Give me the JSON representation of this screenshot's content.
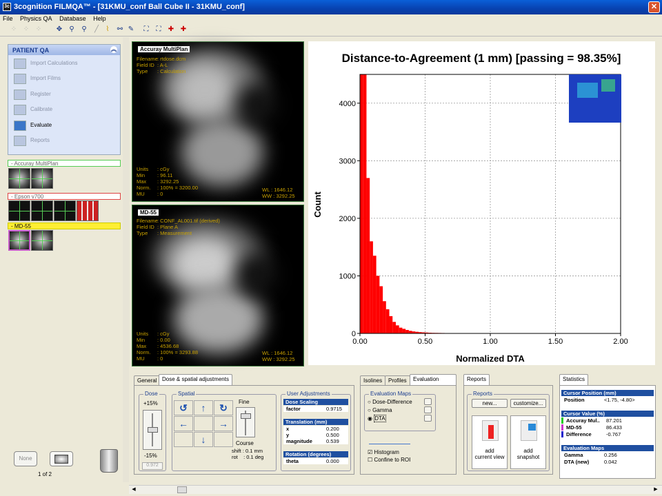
{
  "window": {
    "title": "3cognition FILMQA™ - [31KMU_conf Ball Cube II - 31KMU_conf]",
    "close": "✕"
  },
  "menu": [
    "File",
    "Physics QA",
    "Database",
    "Help"
  ],
  "patient_qa": {
    "title": "PATIENT QA",
    "items": [
      {
        "label": "Import Calculations",
        "active": false
      },
      {
        "label": "Import Films",
        "active": false
      },
      {
        "label": "Register",
        "active": false
      },
      {
        "label": "Calibrate",
        "active": false
      },
      {
        "label": "Evaluate",
        "active": true
      },
      {
        "label": "Reports",
        "active": false
      }
    ]
  },
  "groups": {
    "g1": "- Accuray MultiPlan",
    "g2": "- Epson v700",
    "g3": "- MD-55"
  },
  "nav": {
    "none": "None",
    "count": "1 of 2"
  },
  "image_top": {
    "label": "Accuray MultiPlan",
    "filename_k": "Filename",
    "filename": "rtdose.dcm",
    "field_k": "Field ID",
    "field": "A-L",
    "type_k": "Type",
    "type": "Calculation",
    "units_k": "Units",
    "units": "cGy",
    "min_k": "Min",
    "min": "96.11",
    "max_k": "Max",
    "max": "3292.25",
    "norm_k": "Norm.",
    "norm": "100% = 3200.00",
    "mu_k": "MU",
    "mu": "0",
    "wl_k": "WL",
    "wl": "1646.12",
    "ww_k": "WW",
    "ww": "3292.25"
  },
  "image_bottom": {
    "label": "MD-55",
    "filename_k": "Filename",
    "filename": "CONF_AL001.tif (derived)",
    "field_k": "Field ID",
    "field": "Plane A",
    "type_k": "Type",
    "type": "Measurement",
    "units_k": "Units",
    "units": "cGy",
    "min_k": "Min",
    "min": "0.00",
    "max_k": "Max",
    "max": "4536.68",
    "norm_k": "Norm.",
    "norm": "100% = 3293.88",
    "mu_k": "MU",
    "mu": "0",
    "wl_k": "WL",
    "wl": "1646.12",
    "ww_k": "WW",
    "ww": "3292.25"
  },
  "chart_data": {
    "type": "bar",
    "title": "Distance-to-Agreement (1 mm) [passing = 98.35%]",
    "xlabel": "Normalized DTA",
    "ylabel": "Count",
    "xlim": [
      0,
      2
    ],
    "ylim": [
      0,
      4500
    ],
    "xticks": [
      "0.00",
      "0.50",
      "1.00",
      "1.50",
      "2.00"
    ],
    "yticks": [
      "0",
      "1000",
      "2000",
      "3000",
      "4000"
    ],
    "grid": true,
    "bar_color": "#ff0000",
    "bin_width": 0.025,
    "values": [
      4500,
      4500,
      2700,
      1600,
      1350,
      1000,
      820,
      560,
      420,
      300,
      200,
      140,
      100,
      80,
      60,
      45,
      35,
      28,
      22,
      18,
      15,
      12,
      10,
      9,
      8,
      7,
      6,
      5,
      5,
      4,
      4,
      3,
      3,
      3,
      2,
      2,
      2,
      2,
      2,
      2,
      2,
      2,
      1,
      1,
      1,
      1,
      1,
      1,
      1,
      1,
      1,
      1,
      1,
      1,
      1,
      1,
      1,
      1,
      1,
      1,
      1,
      1,
      1,
      1,
      1,
      1,
      1,
      1,
      1,
      1,
      1,
      1,
      1,
      1,
      1,
      1,
      1,
      1,
      1,
      1
    ]
  },
  "tabs_left": {
    "general": "General",
    "dose": "Dose & spatial adjustments"
  },
  "dose": {
    "legend": "Dose",
    "plus": "+15%",
    "minus": "-15%",
    "value": "0.972"
  },
  "spatial": {
    "legend": "Spatial",
    "fine": "Fine",
    "course": "Course",
    "shift": "shift : 0.1 mm",
    "rot": "rot    : 0.1 deg"
  },
  "user_adj": {
    "legend": "User Adjustments",
    "dose_scaling": "Dose Scaling",
    "factor_k": "factor",
    "factor": "0.9715",
    "translation": "Translation (mm)",
    "x_k": "x",
    "x": "0.200",
    "y_k": "y",
    "y": "0.500",
    "mag_k": "magnitude",
    "mag": "0.539",
    "rotation": "Rotation (degrees)",
    "theta_k": "theta",
    "theta": "0.000"
  },
  "tabs_mid": {
    "isolines": "Isolines",
    "profiles": "Profiles",
    "evalmaps": "Evaluation maps"
  },
  "evalmaps": {
    "legend": "Evaluation Maps",
    "opt1": "Dose-Difference",
    "opt2": "Gamma",
    "opt3": "DTA",
    "histogram": "Histogram",
    "confine": "Confine to ROI"
  },
  "tabs_reports": {
    "reports": "Reports"
  },
  "reports": {
    "legend": "Reports",
    "new": "new...",
    "customize": "customize...",
    "add_view_1": "add",
    "add_view_2": "current view",
    "add_snap_1": "add",
    "add_snap_2": "snapshot"
  },
  "tabs_stats": {
    "statistics": "Statistics"
  },
  "stats": {
    "cursor_pos": "Cursor Position (mm)",
    "position_k": "Position",
    "position": "<1.75, -4.80>",
    "cursor_val": "Cursor Value (%)",
    "accuray_k": "Accuray Mul..",
    "accuray": "87.201",
    "md55_k": "MD-55",
    "md55": "86.433",
    "diff_k": "Difference",
    "diff": "-0.767",
    "eval_maps": "Evaluation Maps",
    "gamma_k": "Gamma",
    "gamma": "0.256",
    "dta_k": "DTA (new)",
    "dta": "0.042"
  }
}
